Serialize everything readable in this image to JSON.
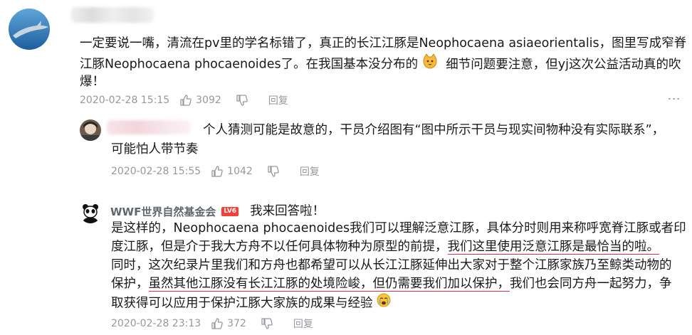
{
  "comment": {
    "text_lines": [
      "一定要说一嘴，清流在pv里的学名标错了，真正的长江江豚是Neophocaena asiaeorientalis，图里写成窄脊",
      "江豚Neophocaena phocaenoides了。在我国基本没分布的",
      "细节问题要注意，但yj这次公益活动真的吹",
      "爆！"
    ],
    "timestamp": "2020-02-28 15:15",
    "likes": "3092",
    "reply_label": "回复"
  },
  "reply1": {
    "text_line1": "个人猜测可能是故意的，干员介绍图有“图中所示干员与现实间物种没有实际联系”，",
    "text_line2": "可能怕人带节奏",
    "timestamp": "2020-02-28 15:55",
    "likes": "1042",
    "reply_label": "回复"
  },
  "reply2": {
    "username": "WWF世界自然基金会",
    "badge": "LV6",
    "intro": "我来回答啦！",
    "line1": "是这样的，Neophocaena phocaenoides我们可以理解泛意江豚，具体分时则用来称呼宽脊江豚或者印",
    "line2_a": "度江豚，但是介于我大方舟不以任何具体物种为原型的前提，",
    "line2_b": "我们这里使用泛意江豚是最恰当的啦。",
    "line3": "同时，这次纪录片里我们和方舟也都希望可以从长江江豚延伸出大家对于整个江豚家族乃至鲸类动物的",
    "line4_a": "保护，",
    "line4_b": "虽然其他江豚没有长江江豚的处境险峻，但仍需要我们加以保护，",
    "line4_c": "我们也会同方舟一起努力，争",
    "line5": "取获得可以应用于保护江豚大家族的成果与经验",
    "timestamp": "2020-02-28 23:13",
    "likes": "372",
    "reply_label": "回复"
  },
  "colors": {
    "meta": "#9499a0",
    "underline": "#e0314b",
    "badge": "#f5403a",
    "text": "#18191c"
  },
  "icons": [
    "thumbs-up-icon",
    "thumbs-down-icon",
    "more-icon",
    "cat-emoji-icon",
    "crying-emoji-icon",
    "panda-logo-icon"
  ]
}
